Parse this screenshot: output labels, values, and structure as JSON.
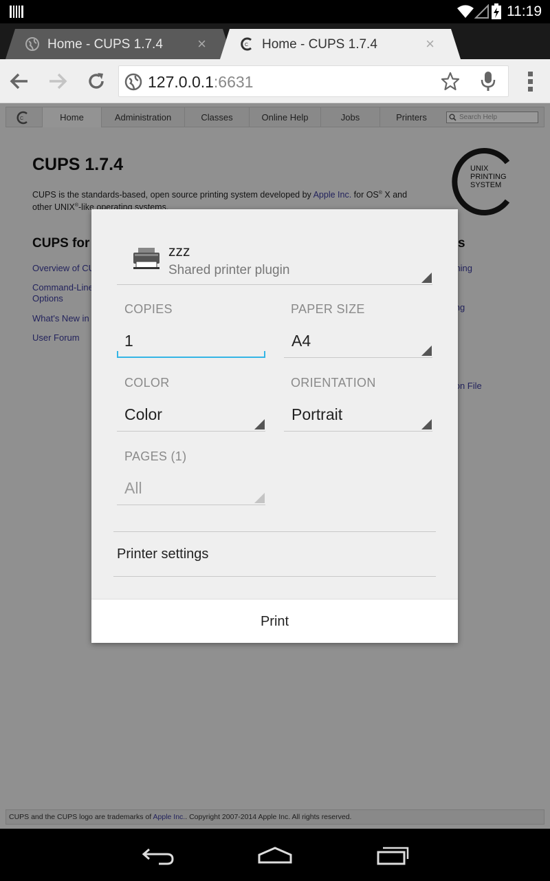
{
  "status_bar": {
    "time": "11:19"
  },
  "tabs": [
    {
      "title": "Home - CUPS 1.7.4",
      "active": false,
      "close": "×"
    },
    {
      "title": "Home - CUPS 1.7.4",
      "active": true,
      "close": "×"
    }
  ],
  "address": {
    "host": "127.0.0.1",
    "port": ":6631"
  },
  "cups_nav": {
    "items": [
      "Home",
      "Administration",
      "Classes",
      "Online Help",
      "Jobs",
      "Printers"
    ],
    "search_placeholder": "Search Help"
  },
  "page": {
    "title": "CUPS 1.7.4",
    "intro_part1": "CUPS is the standards-based, open source printing system developed by ",
    "intro_link": "Apple Inc.",
    "intro_part2": " for OS",
    "intro_reg": "®",
    "intro_part3": " X and",
    "intro_line2a": "other UNIX",
    "intro_line2b": "-like operating systems.",
    "logo_text_1": "UNIX",
    "logo_text_2": "PRINTING",
    "logo_text_3": "SYSTEM",
    "left_heading": "CUPS for",
    "left_links": [
      "Overview of CU",
      "Command-Line",
      "Options",
      "What's New in",
      "User Forum"
    ],
    "right_heading": "ers",
    "right_links": [
      "mming",
      "ming",
      "ation File"
    ]
  },
  "footer": {
    "text1": "CUPS and the CUPS logo are trademarks of ",
    "link": "Apple Inc.",
    "text2": ". Copyright 2007-2014 Apple Inc. All rights reserved."
  },
  "print_dialog": {
    "printer_name": "zzz",
    "printer_subtitle": "Shared printer plugin",
    "copies_label": "COPIES",
    "copies_value": "1",
    "paper_size_label": "PAPER SIZE",
    "paper_size_value": "A4",
    "color_label": "COLOR",
    "color_value": "Color",
    "orientation_label": "ORIENTATION",
    "orientation_value": "Portrait",
    "pages_label": "PAGES (1)",
    "pages_value": "All",
    "printer_settings_label": "Printer settings",
    "print_button": "Print"
  },
  "colors": {
    "accent": "#33b5e5",
    "link": "#3a3a9a"
  },
  "icons": [
    "barcode-icon",
    "wifi-icon",
    "signal-icon",
    "battery-icon",
    "globe-icon",
    "cups-icon",
    "back-arrow-icon",
    "forward-arrow-icon",
    "reload-icon",
    "star-icon",
    "microphone-icon",
    "overflow-menu-icon",
    "printer-icon",
    "nav-back-icon",
    "nav-home-icon",
    "nav-recents-icon"
  ]
}
